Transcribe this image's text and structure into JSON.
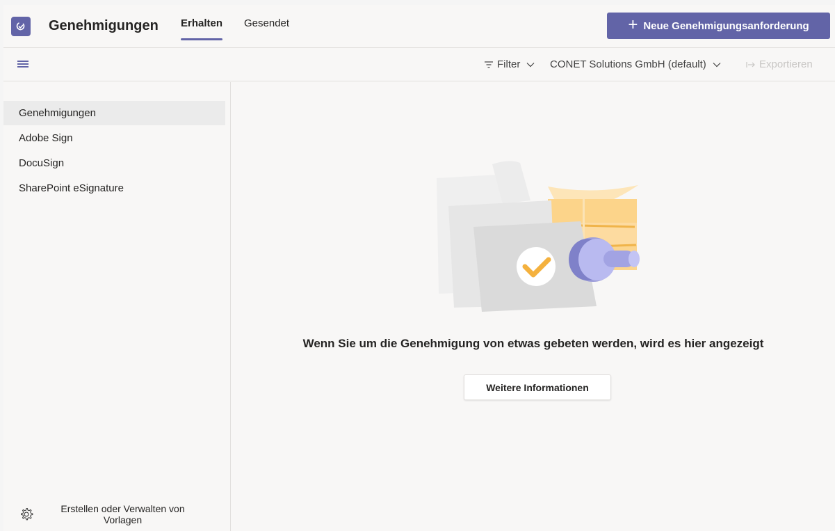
{
  "header": {
    "title": "Genehmigungen",
    "tabs": [
      {
        "label": "Erhalten",
        "active": true
      },
      {
        "label": "Gesendet",
        "active": false
      }
    ],
    "new_button_label": "Neue Genehmigungsanforderung",
    "accent_color": "#6264a7"
  },
  "toolbar": {
    "filter_label": "Filter",
    "environment_label": "CONET Solutions GmbH (default)",
    "export_label": "Exportieren"
  },
  "sidebar": {
    "items": [
      {
        "label": "Genehmigungen",
        "selected": true
      },
      {
        "label": "Adobe Sign",
        "selected": false
      },
      {
        "label": "DocuSign",
        "selected": false
      },
      {
        "label": "SharePoint eSignature",
        "selected": false
      }
    ],
    "templates_label": "Erstellen oder Verwalten von Vorlagen"
  },
  "main": {
    "empty_message": "Wenn Sie um die Genehmigung von etwas gebeten werden, wird es hier angezeigt",
    "info_button_label": "Weitere Informationen"
  }
}
